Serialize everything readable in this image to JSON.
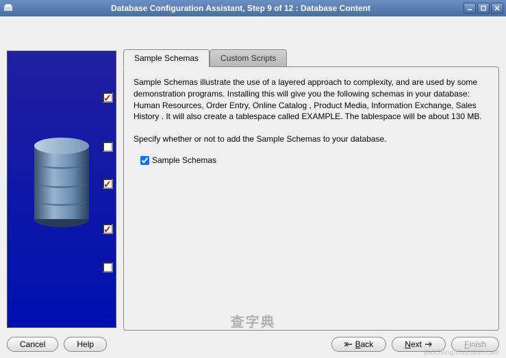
{
  "window": {
    "title": "Database Configuration Assistant, Step 9 of 12 : Database Content"
  },
  "tabs": {
    "sample": "Sample Schemas",
    "custom": "Custom Scripts"
  },
  "content": {
    "description": "Sample Schemas illustrate the use of a layered approach to complexity, and are used by some demonstration programs. Installing this will give you the following schemas in your database: Human Resources, Order Entry, Online Catalog , Product Media, Information Exchange, Sales History . It will also create a tablespace called EXAMPLE. The tablespace will be about 130 MB.",
    "prompt": "Specify whether or not to add the Sample Schemas to your database.",
    "checkbox_label": "Sample Schemas"
  },
  "buttons": {
    "cancel": "Cancel",
    "help": "Help",
    "back_prefix": "B",
    "back_suffix": "ack",
    "next_prefix": "N",
    "next_suffix": "ext",
    "finish_prefix": "F",
    "finish_suffix": "inish"
  },
  "steps": [
    {
      "checked": true
    },
    {
      "checked": false
    },
    {
      "checked": true
    },
    {
      "checked": true
    },
    {
      "checked": false
    }
  ],
  "watermark": "jiaocheng.chazidian.com",
  "overlay": "查字典"
}
